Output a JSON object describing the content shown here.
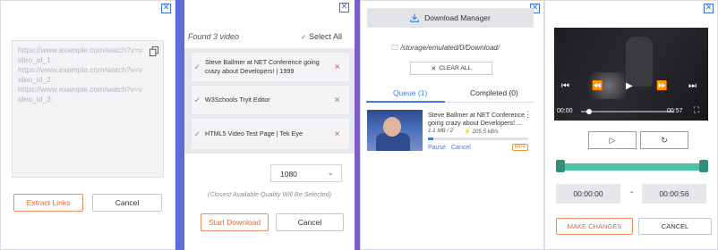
{
  "panel1": {
    "close": "✕",
    "urls_text": "https://www.example.com/watch?v=video_id_1\nhttps://www.example.com/watch?v=video_id_2\nhttps://www.example.com/watch?v=video_id_3",
    "extract_label": "Extract Links",
    "cancel_label": "Cancel"
  },
  "panel2": {
    "close": "✕",
    "found_text": "Found 3 video",
    "select_all": "Select All",
    "videos": [
      {
        "title": "Steve Ballmer at NET Conference going crazy about Developers! | 1999"
      },
      {
        "title": "W3Schools Tryit Editor"
      },
      {
        "title": "HTML5 Video Test Page | Tek Eye"
      }
    ],
    "quality": "1080",
    "quality_note": "(Closest Available Quality Will Be Selected)",
    "start_label": "Start Download",
    "cancel_label": "Cancel"
  },
  "panel3": {
    "close": "✕",
    "download_manager": "Download Manager",
    "path": "/storage/emulated/0/Download/",
    "clear_all": "CLEAR ALL",
    "tab_queue": "Queue (1)",
    "tab_completed": "Completed (0)",
    "item": {
      "title": "Steve Ballmer at NET Conference going crazy about Developers! ...",
      "size": "1.1 MB / 2",
      "speed": "205.5 kB/s",
      "progress": 0.05,
      "pause": "Pause",
      "cancel": "Cancel",
      "format": "MP4"
    }
  },
  "panel4": {
    "close": "✕",
    "time_current": "00:00",
    "time_total": "00:57",
    "start_time": "00:00:00",
    "end_time": "00:00:56",
    "dash": "-",
    "make_changes": "MAKE CHANGES",
    "cancel_label": "CANCEL"
  },
  "colors": {
    "accent_blue": "#3f7fe0",
    "accent_orange": "#e0693a",
    "range_green": "#4cc1a4",
    "close_red": "#e14b3b"
  }
}
